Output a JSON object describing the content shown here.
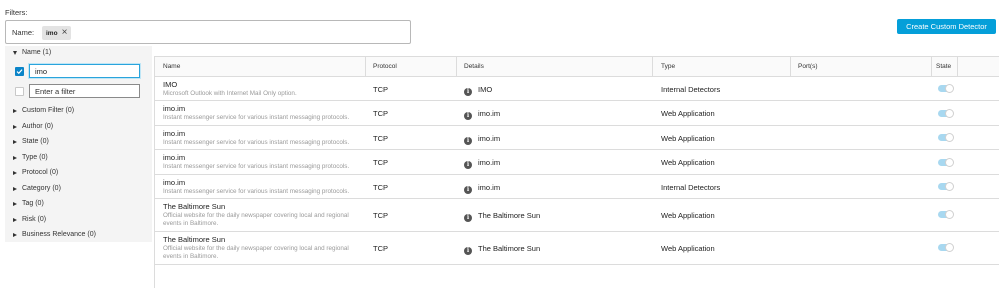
{
  "filters": {
    "label": "Filters:",
    "name_label": "Name:",
    "chip_value": "imo"
  },
  "create_button": "Create Custom Detector",
  "left_panel": {
    "name_section": "Name (1)",
    "name_input_value": "imo",
    "enter_filter_placeholder": "Enter a filter",
    "categories": [
      "Custom Filter (0)",
      "Author (0)",
      "State (0)",
      "Type (0)",
      "Protocol (0)",
      "Category (0)",
      "Tag (0)",
      "Risk (0)",
      "Business Relevance (0)"
    ]
  },
  "table": {
    "headers": [
      "Name",
      "Protocol",
      "Details",
      "Type",
      "Port(s)",
      "State"
    ],
    "rows": [
      {
        "name": "IMO",
        "desc": "Microsoft Outlook with Internet Mail Only option.",
        "protocol": "TCP",
        "details": "IMO",
        "type": "Internal Detectors",
        "ports": "",
        "state": "on"
      },
      {
        "name": "imo.im",
        "desc": "Instant messenger service for various instant messaging protocols.",
        "protocol": "TCP",
        "details": "imo.im",
        "type": "Web Application",
        "ports": "",
        "state": "on"
      },
      {
        "name": "imo.im",
        "desc": "Instant messenger service for various instant messaging protocols.",
        "protocol": "TCP",
        "details": "imo.im",
        "type": "Web Application",
        "ports": "",
        "state": "on"
      },
      {
        "name": "imo.im",
        "desc": "Instant messenger service for various instant messaging protocols.",
        "protocol": "TCP",
        "details": "imo.im",
        "type": "Web Application",
        "ports": "",
        "state": "on"
      },
      {
        "name": "imo.im",
        "desc": "Instant messenger service for various instant messaging protocols.",
        "protocol": "TCP",
        "details": "imo.im",
        "type": "Internal Detectors",
        "ports": "",
        "state": "on"
      },
      {
        "name": "The Baltimore Sun",
        "desc": "Official website for the daily newspaper covering local and regional events in Baltimore.",
        "protocol": "TCP",
        "details": "The Baltimore Sun",
        "type": "Web Application",
        "ports": "",
        "state": "on"
      },
      {
        "name": "The Baltimore Sun",
        "desc": "Official website for the daily newspaper covering local and regional events in Baltimore.",
        "protocol": "TCP",
        "details": "The Baltimore Sun",
        "type": "Web Application",
        "ports": "",
        "state": "on"
      }
    ]
  },
  "colors": {
    "accent": "#049fd9",
    "checkbox": "#0a84c8",
    "toggle_on": "#a8d8f0"
  },
  "icons": {
    "chip_close": "close-icon",
    "details_info": "info-icon",
    "expand": "caret-right-icon",
    "collapse": "caret-down-icon",
    "check": "checkmark-icon"
  }
}
